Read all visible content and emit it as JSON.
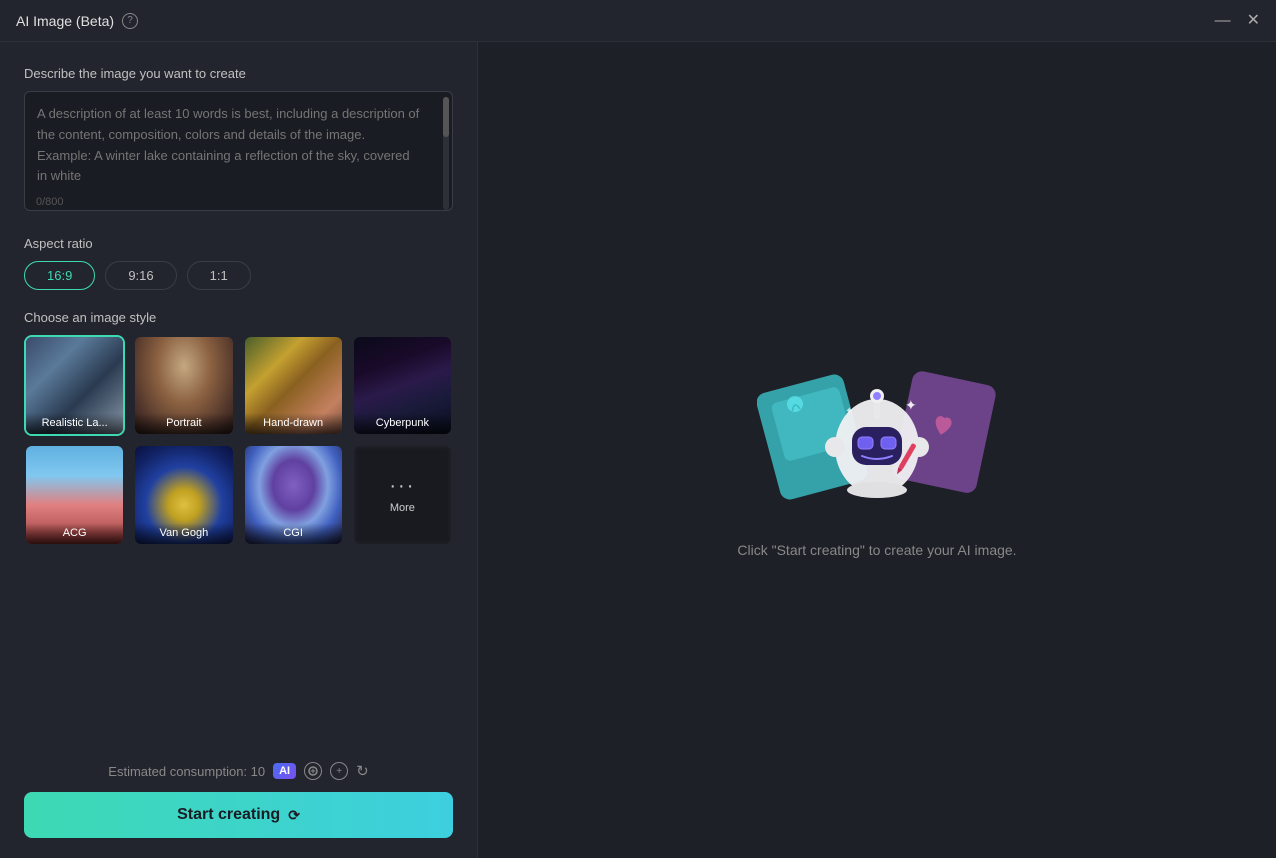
{
  "titlebar": {
    "title": "AI Image (Beta)",
    "help_icon": "?",
    "minimize_icon": "—",
    "close_icon": "✕"
  },
  "left": {
    "describe_label": "Describe the image you want to create",
    "textarea_placeholder": "A description of at least 10 words is best, including a description of the content, composition, colors and details of the image. Example: A winter lake containing a reflection of the sky, covered in white",
    "char_count": "0/800",
    "aspect_ratio": {
      "label": "Aspect ratio",
      "options": [
        "16:9",
        "9:16",
        "1:1"
      ],
      "selected": "16:9"
    },
    "style_label": "Choose an image style",
    "styles": [
      {
        "id": "realistic",
        "label": "Realistic La...",
        "bg": "realistic",
        "selected": true
      },
      {
        "id": "portrait",
        "label": "Portrait",
        "bg": "portrait",
        "selected": false
      },
      {
        "id": "handdrawn",
        "label": "Hand-drawn",
        "bg": "handdrawn",
        "selected": false
      },
      {
        "id": "cyberpunk",
        "label": "Cyberpunk",
        "bg": "cyberpunk",
        "selected": false
      },
      {
        "id": "acg",
        "label": "ACG",
        "bg": "acg",
        "selected": false
      },
      {
        "id": "vangogh",
        "label": "Van Gogh",
        "bg": "vangogh",
        "selected": false
      },
      {
        "id": "cgi",
        "label": "CGI",
        "bg": "cgi",
        "selected": false
      },
      {
        "id": "more",
        "label": "More",
        "bg": "more",
        "selected": false
      }
    ],
    "estimated_consumption_text": "Estimated consumption: 10",
    "start_button_label": "Start creating"
  },
  "right": {
    "hint_text": "Click \"Start creating\" to create your AI image."
  }
}
